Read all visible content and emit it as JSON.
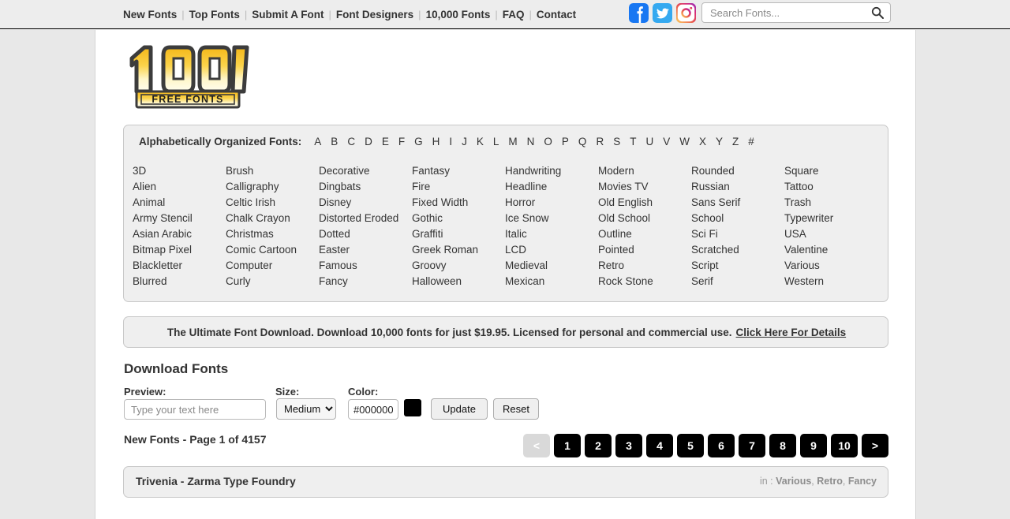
{
  "topnav": {
    "items": [
      {
        "label": "New Fonts"
      },
      {
        "label": "Top Fonts"
      },
      {
        "label": "Submit A Font"
      },
      {
        "label": "Font Designers"
      },
      {
        "label": "10,000 Fonts"
      },
      {
        "label": "FAQ"
      },
      {
        "label": "Contact"
      }
    ],
    "separator": "|"
  },
  "social": [
    {
      "name": "facebook-icon",
      "color": "#1877F2"
    },
    {
      "name": "twitter-icon",
      "color": "#1DA1F2"
    },
    {
      "name": "instagram-icon",
      "color": "#E1306C"
    }
  ],
  "search": {
    "placeholder": "Search Fonts...",
    "value": "",
    "icon": "search-icon"
  },
  "logo": {
    "number": "1001",
    "tagline": "FREE FONTS",
    "gold": "#F5C518",
    "gold_light": "#FFF0A8",
    "outline": "#3A3A3A"
  },
  "alphabet": {
    "title": "Alphabetically Organized Fonts:",
    "letters": [
      "A",
      "B",
      "C",
      "D",
      "E",
      "F",
      "G",
      "H",
      "I",
      "J",
      "K",
      "L",
      "M",
      "N",
      "O",
      "P",
      "Q",
      "R",
      "S",
      "T",
      "U",
      "V",
      "W",
      "X",
      "Y",
      "Z",
      "#"
    ]
  },
  "categories": [
    [
      "3D",
      "Alien",
      "Animal",
      "Army Stencil",
      "Asian Arabic",
      "Bitmap Pixel",
      "Blackletter",
      "Blurred"
    ],
    [
      "Brush",
      "Calligraphy",
      "Celtic Irish",
      "Chalk Crayon",
      "Christmas",
      "Comic Cartoon",
      "Computer",
      "Curly"
    ],
    [
      "Decorative",
      "Dingbats",
      "Disney",
      "Distorted Eroded",
      "Dotted",
      "Easter",
      "Famous",
      "Fancy"
    ],
    [
      "Fantasy",
      "Fire",
      "Fixed Width",
      "Gothic",
      "Graffiti",
      "Greek Roman",
      "Groovy",
      "Halloween"
    ],
    [
      "Handwriting",
      "Headline",
      "Horror",
      "Ice Snow",
      "Italic",
      "LCD",
      "Medieval",
      "Mexican"
    ],
    [
      "Modern",
      "Movies TV",
      "Old English",
      "Old School",
      "Outline",
      "Pointed",
      "Retro",
      "Rock Stone"
    ],
    [
      "Rounded",
      "Russian",
      "Sans Serif",
      "School",
      "Sci Fi",
      "Scratched",
      "Script",
      "Serif"
    ],
    [
      "Square",
      "Tattoo",
      "Trash",
      "Typewriter",
      "USA",
      "Valentine",
      "Various",
      "Western"
    ]
  ],
  "promo": {
    "text": "The Ultimate Font Download. Download 10,000 fonts for just $19.95. Licensed for personal and commercial use.",
    "link_label": "Click Here For Details"
  },
  "download_section": {
    "title": "Download Fonts",
    "preview_label": "Preview:",
    "preview_placeholder": "Type your text here",
    "preview_value": "",
    "size_label": "Size:",
    "size_value": "Medium",
    "size_options": [
      "Medium"
    ],
    "color_label": "Color:",
    "color_value": "#000000",
    "color_swatch": "#000000",
    "update_label": "Update",
    "reset_label": "Reset"
  },
  "results": {
    "heading": "New Fonts - Page 1 of 4157",
    "rows": [
      {
        "name": "Trivenia - Zarma Type Foundry",
        "in_label": "in :",
        "tags": [
          "Various",
          "Retro",
          "Fancy"
        ]
      }
    ]
  },
  "pagination": {
    "prev_label": "<",
    "next_label": ">",
    "pages": [
      "1",
      "2",
      "3",
      "4",
      "5",
      "6",
      "7",
      "8",
      "9",
      "10"
    ],
    "active": "1"
  }
}
